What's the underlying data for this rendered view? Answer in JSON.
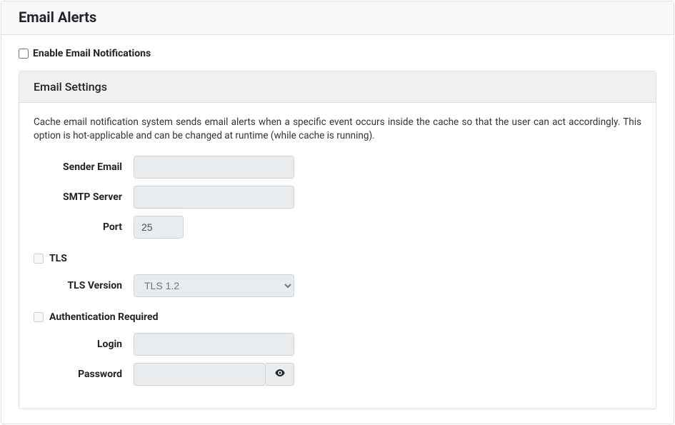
{
  "page": {
    "title": "Email Alerts",
    "enable_label": "Enable Email Notifications"
  },
  "settings": {
    "title": "Email Settings",
    "description": "Cache email notification system sends email alerts when a specific event occurs inside the cache so that the user can act accordingly. This option is hot-applicable and can be changed at runtime (while cache is running).",
    "sender_email_label": "Sender Email",
    "sender_email_value": "",
    "smtp_server_label": "SMTP Server",
    "smtp_server_value": "",
    "port_label": "Port",
    "port_value": "25",
    "tls_label": "TLS",
    "tls_version_label": "TLS Version",
    "tls_version_value": "TLS 1.2",
    "auth_required_label": "Authentication Required",
    "login_label": "Login",
    "login_value": "",
    "password_label": "Password",
    "password_value": ""
  }
}
